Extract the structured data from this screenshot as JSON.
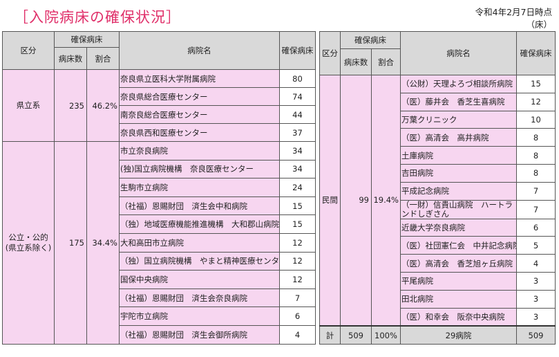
{
  "header": {
    "title": "［入院病床の確保状況］",
    "as_of_line1": "令和4年2月7日時点",
    "as_of_line2": "（床）"
  },
  "columns": {
    "category": "区分",
    "secured": "確保病床",
    "beds": "病床数",
    "ratio": "割合",
    "hospital": "病院名",
    "hospital_beds": "確保病床"
  },
  "left_groups": [
    {
      "category": "県立系",
      "beds": "235",
      "ratio": "46.2%",
      "hospitals": [
        {
          "name": "奈良県立医科大学附属病院",
          "beds": "80"
        },
        {
          "name": "奈良県総合医療センター",
          "beds": "74"
        },
        {
          "name": "南奈良総合医療センター",
          "beds": "44"
        },
        {
          "name": "奈良県西和医療センター",
          "beds": "37"
        }
      ]
    },
    {
      "category": "公立・公的\n(県立系除く)",
      "beds": "175",
      "ratio": "34.4%",
      "hospitals": [
        {
          "name": "市立奈良病院",
          "beds": "34"
        },
        {
          "name": "(独)国立病院機構　奈良医療センター",
          "beds": "34"
        },
        {
          "name": "生駒市立病院",
          "beds": "24"
        },
        {
          "name": "（社福）恩賜財団　済生会中和病院",
          "beds": "15"
        },
        {
          "name": "（独）地域医療機能推進機構　大和郡山病院",
          "beds": "15"
        },
        {
          "name": "大和高田市立病院",
          "beds": "12"
        },
        {
          "name": "（独）国立病院機構　やまと精神医療センター",
          "beds": "12"
        },
        {
          "name": "国保中央病院",
          "beds": "12"
        },
        {
          "name": "（社福）恩賜財団　済生会奈良病院",
          "beds": "7"
        },
        {
          "name": "宇陀市立病院",
          "beds": "6"
        },
        {
          "name": "（社福）恩賜財団　済生会御所病院",
          "beds": "4"
        }
      ]
    }
  ],
  "right_group": {
    "category": "民間",
    "beds": "99",
    "ratio": "19.4%",
    "hospitals": [
      {
        "name": "（公財）天理よろづ相談所病院",
        "beds": "15"
      },
      {
        "name": "（医）藤井会　香芝生喜病院",
        "beds": "12"
      },
      {
        "name": "万葉クリニック",
        "beds": "10"
      },
      {
        "name": "（医）高清会　高井病院",
        "beds": "8"
      },
      {
        "name": "土庫病院",
        "beds": "8"
      },
      {
        "name": "吉田病院",
        "beds": "8"
      },
      {
        "name": "平成記念病院",
        "beds": "7"
      },
      {
        "name": "（一財）信貴山病院　ハートランドしぎさん",
        "beds": "7"
      },
      {
        "name": "近畿大学奈良病院",
        "beds": "6"
      },
      {
        "name": "（医）社団憲仁会　中井記念病院",
        "beds": "5"
      },
      {
        "name": "（医）高清会　香芝旭ヶ丘病院",
        "beds": "4"
      },
      {
        "name": "平尾病院",
        "beds": "3"
      },
      {
        "name": "田北病院",
        "beds": "3"
      },
      {
        "name": "（医）和幸会　阪奈中央病院",
        "beds": "3"
      }
    ]
  },
  "total": {
    "label": "計",
    "beds": "509",
    "ratio": "100%",
    "hospitals": "29病院",
    "hospital_beds": "509"
  }
}
